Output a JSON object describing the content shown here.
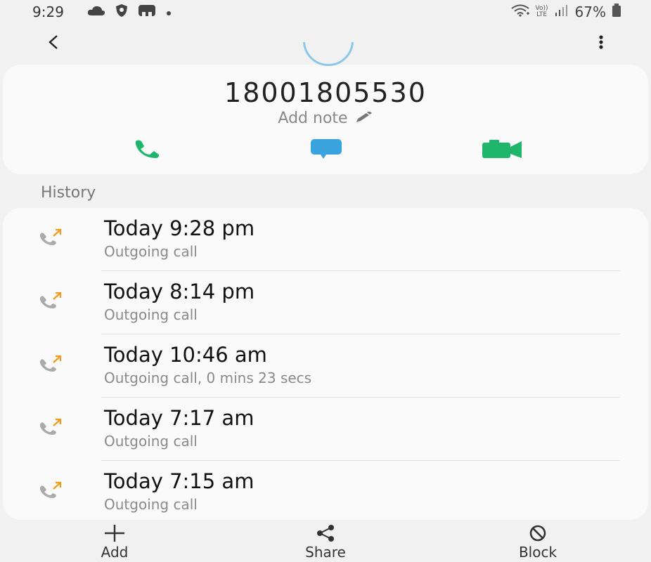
{
  "status_bar": {
    "time": "9:29",
    "left_icons": [
      "cloud-icon",
      "shield-icon",
      "notification-icon",
      "dot-icon"
    ],
    "right_icons": [
      "wifi-icon",
      "volte-icon",
      "signal-icon",
      "battery-icon"
    ],
    "volte_top": "Vo))",
    "volte_bottom": "LTE",
    "battery": "67%"
  },
  "app_bar": {
    "back_icon": "chevron-left-icon",
    "more_icon": "more-vertical-icon"
  },
  "contact": {
    "phone_number": "18001805530",
    "add_note_label": "Add note",
    "actions": [
      {
        "icon": "phone-icon",
        "color": "#1fb56a"
      },
      {
        "icon": "message-icon",
        "color": "#3aa2dc"
      },
      {
        "icon": "video-call-icon",
        "color": "#1fb56a"
      }
    ]
  },
  "history": {
    "title": "History",
    "items": [
      {
        "time": "Today 9:28 pm",
        "type": "Outgoing call"
      },
      {
        "time": "Today 8:14 pm",
        "type": "Outgoing call"
      },
      {
        "time": "Today 10:46 am",
        "type": "Outgoing call, 0 mins 23 secs"
      },
      {
        "time": "Today 7:17 am",
        "type": "Outgoing call"
      },
      {
        "time": "Today 7:15 am",
        "type": "Outgoing call"
      }
    ]
  },
  "bottom_bar": {
    "add_label": "Add",
    "share_label": "Share",
    "block_label": "Block"
  },
  "colors": {
    "call_green": "#1fb56a",
    "message_blue": "#3aa2dc",
    "outgoing_arrow": "#f29a1a"
  }
}
